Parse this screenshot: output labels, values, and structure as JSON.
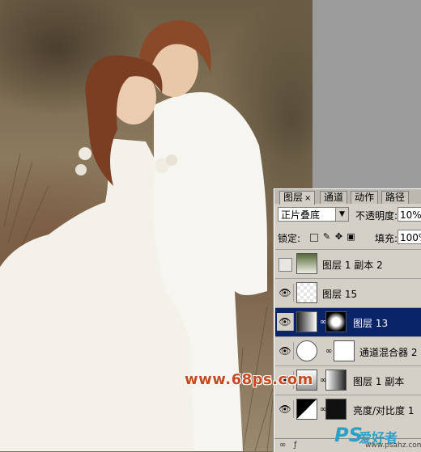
{
  "tabs": [
    {
      "label": "图层",
      "close": "×"
    },
    {
      "label": "通道"
    },
    {
      "label": "动作"
    },
    {
      "label": "路径"
    }
  ],
  "blend_mode": "正片叠底",
  "opacity_label": "不透明度:",
  "opacity_value": "10%",
  "lock_label": "锁定:",
  "fill_label": "填充:",
  "fill_value": "100%",
  "layers": [
    {
      "name": "图层 1 副本 2",
      "visible": false
    },
    {
      "name": "图层 15",
      "visible": true
    },
    {
      "name": "图层 13",
      "visible": true,
      "selected": true
    },
    {
      "name": "通道混合器 2",
      "visible": true
    },
    {
      "name": "图层 1 副本",
      "visible": true
    },
    {
      "name": "亮度/对比度 1",
      "visible": true
    }
  ],
  "watermark": "www.68ps.com",
  "logo": {
    "ps": "PS",
    "cn": "爱好者",
    "url": "www.psahz.com"
  },
  "colors": {
    "selected_layer": "#0a246a",
    "panel_bg": "#d4d0c8",
    "watermark": "#c94a1f"
  }
}
